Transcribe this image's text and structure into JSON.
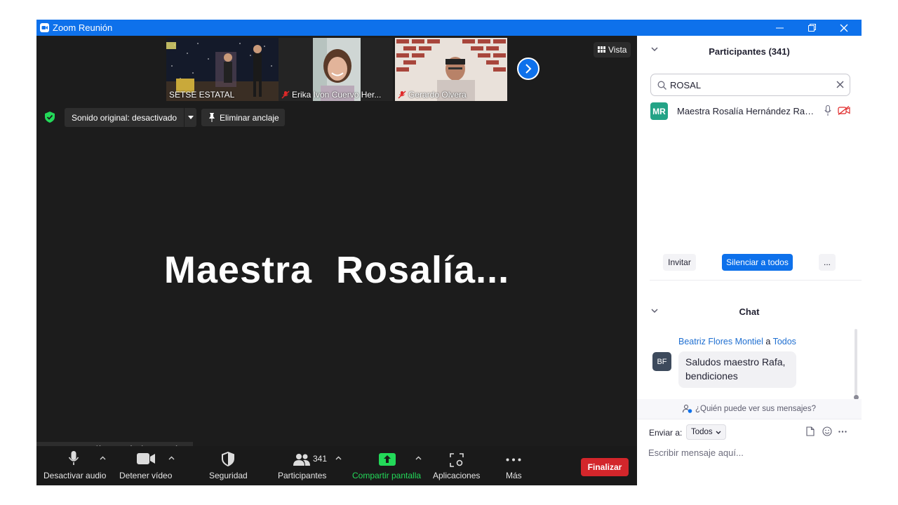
{
  "window": {
    "title": "Zoom Reunión"
  },
  "video": {
    "thumbnails": [
      {
        "name": "SETSE ESTATAL",
        "muted": false
      },
      {
        "name": "Erika Ivon Cuervo Her...",
        "muted": true
      },
      {
        "name": "Gerardo Olvera",
        "muted": true
      }
    ],
    "view_label": "Vista",
    "sound_label": "Sonido original: desactivado",
    "unpin_label": "Eliminar anclaje",
    "active_speaker_display": "Maestra  Rosalía...",
    "name_tag": "Maestra Rosalía Hernández Ramírez"
  },
  "toolbar": {
    "audio_label": "Desactivar audio",
    "video_label": "Detener vídeo",
    "security_label": "Seguridad",
    "participants_label": "Participantes",
    "participants_count": "341",
    "share_label": "Compartir pantalla",
    "apps_label": "Aplicaciones",
    "more_label": "Más",
    "end_label": "Finalizar"
  },
  "participants_panel": {
    "title": "Participantes (341)",
    "search_value": "ROSAL",
    "participants": [
      {
        "initials": "MR",
        "name": "Maestra Rosalía Hernández Ramí..."
      }
    ],
    "invite_label": "Invitar",
    "mute_all_label": "Silenciar a todos",
    "more_label": "..."
  },
  "chat": {
    "title": "Chat",
    "messages": [
      {
        "initials": "BF",
        "from": "Beatriz Flores Montiel",
        "to_word": "a",
        "target": "Todos",
        "text_line1": "Saludos maestro Rafa,",
        "text_line2": "bendiciones"
      }
    ],
    "who_can_see": "¿Quién puede ver sus mensajes?",
    "send_to_label": "Enviar a:",
    "send_to_value": "Todos",
    "input_placeholder": "Escribir mensaje aquí..."
  },
  "colors": {
    "accent": "#0e71eb",
    "end": "#d3262b",
    "share": "#23d959",
    "avatar_mr": "#23a386"
  }
}
